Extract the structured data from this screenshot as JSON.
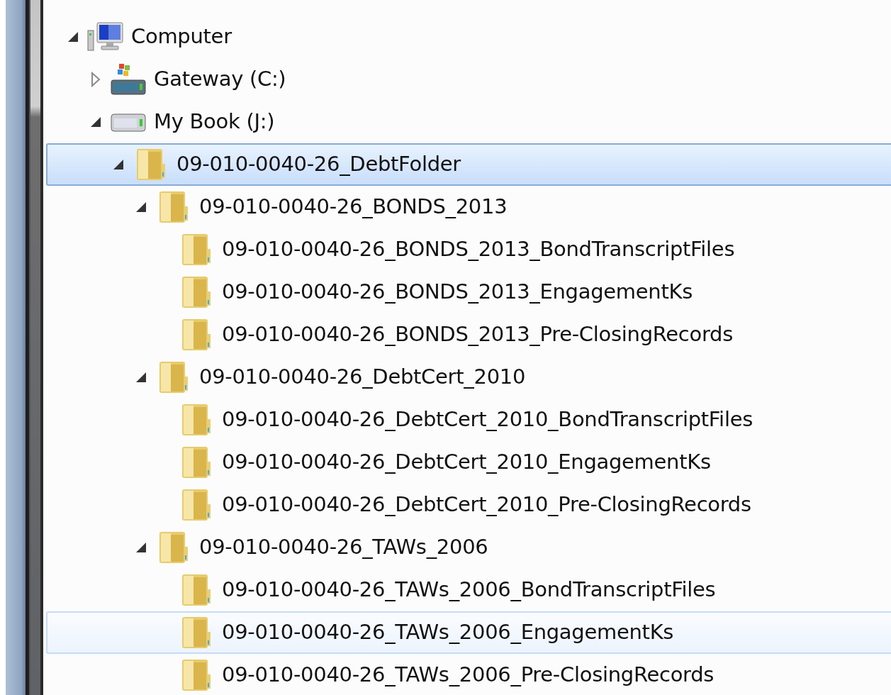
{
  "tree": [
    {
      "label": "Computer",
      "kind": "computer",
      "expanded": true,
      "selected": false,
      "hovered": false,
      "children": [
        {
          "label": "Gateway (C:)",
          "kind": "system-drive",
          "expanded": false,
          "selected": false,
          "hovered": false
        },
        {
          "label": "My Book (J:)",
          "kind": "drive",
          "expanded": true,
          "selected": false,
          "hovered": false,
          "children": [
            {
              "label": "09-010-0040-26_DebtFolder",
              "kind": "folder",
              "expanded": true,
              "selected": true,
              "hovered": false,
              "children": [
                {
                  "label": "09-010-0040-26_BONDS_2013",
                  "kind": "folder",
                  "expanded": true,
                  "selected": false,
                  "hovered": false,
                  "children": [
                    {
                      "label": "09-010-0040-26_BONDS_2013_BondTranscriptFiles",
                      "kind": "folder",
                      "selected": false,
                      "hovered": false
                    },
                    {
                      "label": "09-010-0040-26_BONDS_2013_EngagementKs",
                      "kind": "folder",
                      "selected": false,
                      "hovered": false
                    },
                    {
                      "label": "09-010-0040-26_BONDS_2013_Pre-ClosingRecords",
                      "kind": "folder",
                      "selected": false,
                      "hovered": false
                    }
                  ]
                },
                {
                  "label": "09-010-0040-26_DebtCert_2010",
                  "kind": "folder",
                  "expanded": true,
                  "selected": false,
                  "hovered": false,
                  "children": [
                    {
                      "label": "09-010-0040-26_DebtCert_2010_BondTranscriptFiles",
                      "kind": "folder",
                      "selected": false,
                      "hovered": false
                    },
                    {
                      "label": "09-010-0040-26_DebtCert_2010_EngagementKs",
                      "kind": "folder",
                      "selected": false,
                      "hovered": false
                    },
                    {
                      "label": "09-010-0040-26_DebtCert_2010_Pre-ClosingRecords",
                      "kind": "folder",
                      "selected": false,
                      "hovered": false
                    }
                  ]
                },
                {
                  "label": "09-010-0040-26_TAWs_2006",
                  "kind": "folder",
                  "expanded": true,
                  "selected": false,
                  "hovered": false,
                  "children": [
                    {
                      "label": "09-010-0040-26_TAWs_2006_BondTranscriptFiles",
                      "kind": "folder",
                      "selected": false,
                      "hovered": false
                    },
                    {
                      "label": "09-010-0040-26_TAWs_2006_EngagementKs",
                      "kind": "folder",
                      "selected": false,
                      "hovered": true
                    },
                    {
                      "label": "09-010-0040-26_TAWs_2006_Pre-ClosingRecords",
                      "kind": "folder",
                      "selected": false,
                      "hovered": false
                    }
                  ]
                }
              ]
            }
          ]
        }
      ]
    }
  ]
}
